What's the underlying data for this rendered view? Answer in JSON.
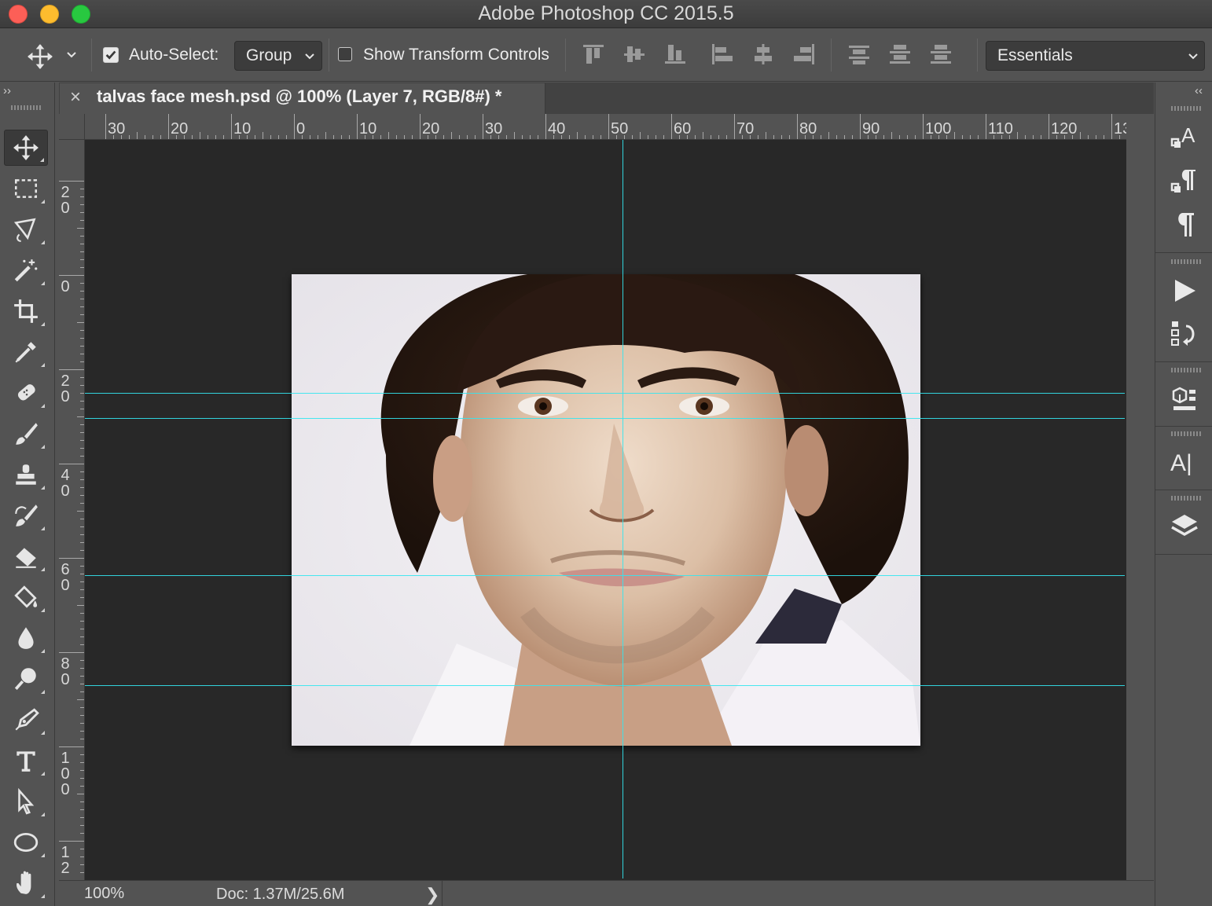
{
  "window": {
    "title": "Adobe Photoshop CC 2015.5",
    "traffic_colors": {
      "close": "#fc5f57",
      "minimize": "#fdbc2e",
      "maximize": "#28c840"
    }
  },
  "options_bar": {
    "auto_select_label": "Auto-Select:",
    "auto_select_checked": true,
    "auto_select_mode": "Group",
    "show_transform_label": "Show Transform Controls",
    "show_transform_checked": false,
    "workspace": "Essentials"
  },
  "document": {
    "tab_title": "talvas face mesh.psd @ 100% (Layer 7, RGB/8#) *",
    "close_glyph": "×"
  },
  "rulers": {
    "horizontal": [
      "30",
      "20",
      "10",
      "0",
      "10",
      "20",
      "30",
      "40",
      "50",
      "60",
      "70",
      "80",
      "90",
      "100",
      "110",
      "120",
      "13"
    ],
    "vertical": [
      [
        "2",
        "0"
      ],
      [
        "0"
      ],
      [
        "2",
        "0"
      ],
      [
        "4",
        "0"
      ],
      [
        "6",
        "0"
      ],
      [
        "8",
        "0"
      ],
      [
        "1",
        "0",
        "0"
      ],
      [
        "1",
        "2"
      ]
    ]
  },
  "status": {
    "zoom": "100%",
    "doc_info": "Doc: 1.37M/25.6M",
    "arrow": "❯"
  },
  "panel_toggles": {
    "left": "››",
    "right": "‹‹"
  },
  "tools": [
    "move-tool",
    "marquee-tool",
    "lasso-tool",
    "magic-wand-tool",
    "crop-tool",
    "eyedropper-tool",
    "healing-brush-tool",
    "brush-tool",
    "clone-stamp-tool",
    "history-brush-tool",
    "eraser-tool",
    "paint-bucket-tool",
    "blur-tool",
    "dodge-tool",
    "pen-tool",
    "type-tool",
    "path-selection-tool",
    "ellipse-tool",
    "hand-tool"
  ],
  "dock_panels": {
    "character_glyph": "A",
    "paragraph_glyph": "¶",
    "glyph_styles": "A|"
  },
  "colors": {
    "guide": "#33e6f0",
    "canvas_bg": "#282828",
    "ui_bg": "#535353"
  }
}
